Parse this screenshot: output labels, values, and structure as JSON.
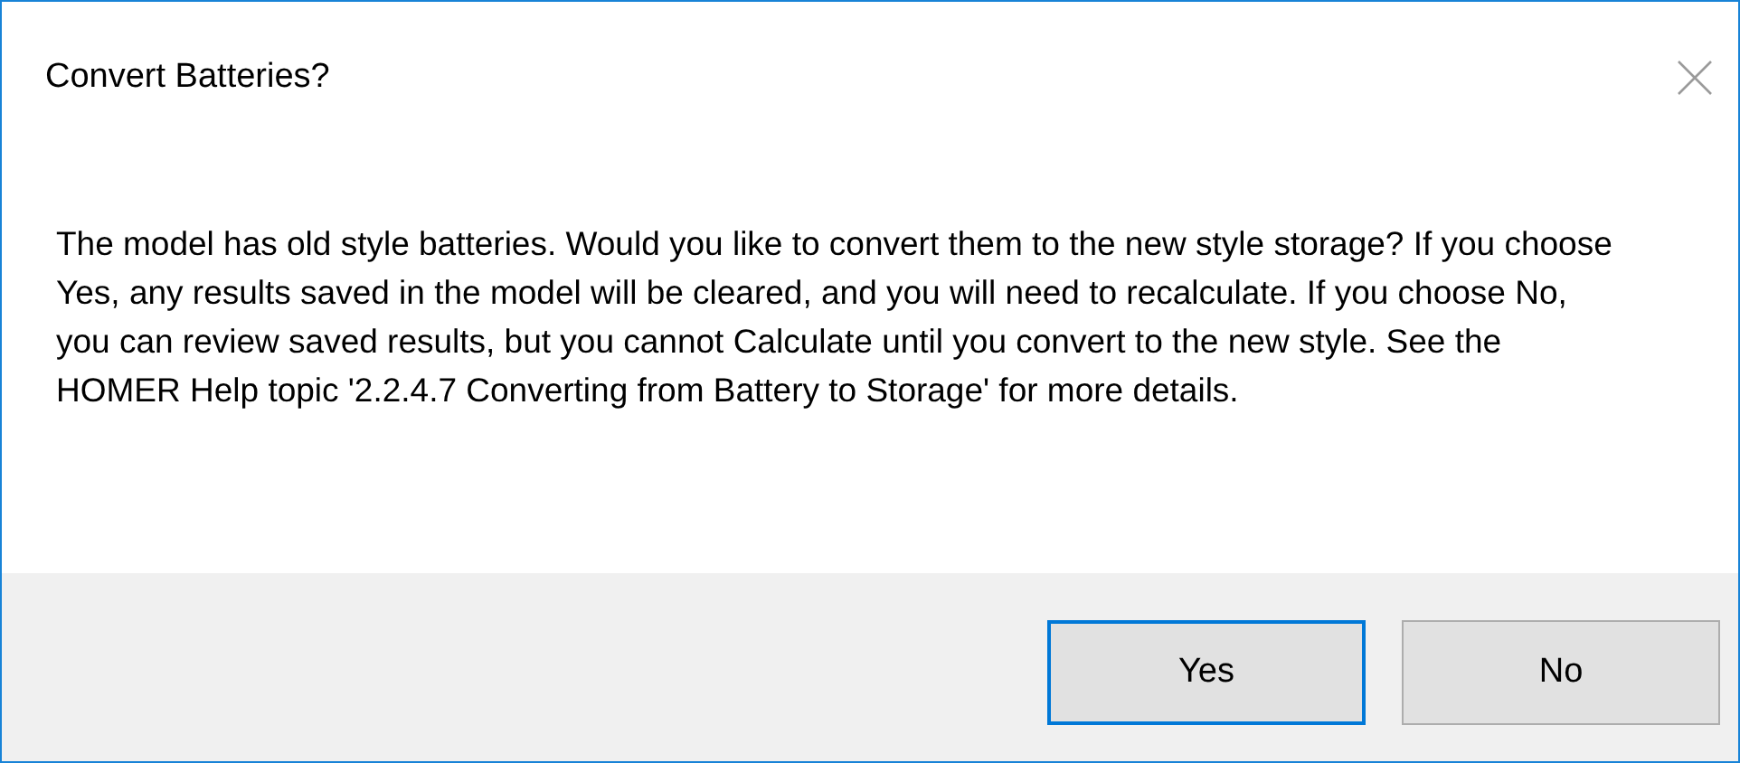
{
  "window": {
    "title": "Convert Batteries?"
  },
  "message": "The model has old style batteries. Would you like to convert them to the new style storage? If you choose Yes, any results saved in the model will be cleared, and you will need to recalculate. If you choose No, you can review saved results, but you cannot Calculate until you convert to the new style. See the HOMER Help topic '2.2.4.7 Converting from Battery to Storage' for more details.",
  "buttons": [
    {
      "label": "Yes",
      "default": true
    },
    {
      "label": "No",
      "default": false
    }
  ]
}
